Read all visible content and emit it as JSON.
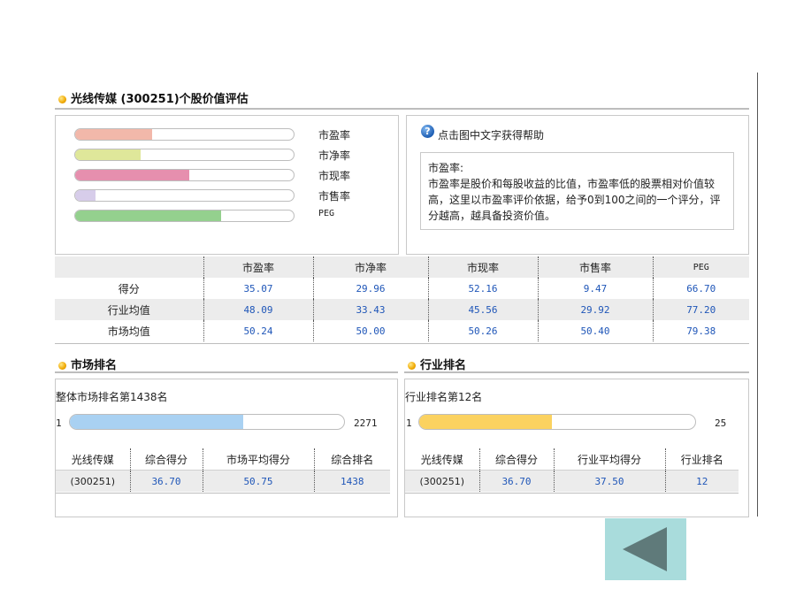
{
  "page": {
    "title": "光线传媒 (300251)个股价值评估",
    "colors": {
      "accent_blue": "#1f56b8",
      "section_rule": "#bdbdbd",
      "back_button_bg": "#a9dcdc",
      "back_arrow": "#5f7a7a"
    }
  },
  "chart_data": {
    "type": "bar",
    "orientation": "horizontal",
    "categories": [
      "市盈率",
      "市净率",
      "市现率",
      "市售率",
      "PEG"
    ],
    "values": [
      35.07,
      29.96,
      52.16,
      9.47,
      66.7
    ],
    "xlim": [
      0,
      100
    ],
    "colors": [
      "#f2b8aa",
      "#dfe79a",
      "#e68fae",
      "#d7cdea",
      "#94d08e"
    ]
  },
  "help": {
    "title": "点击图中文字获得帮助",
    "term": "市盈率:",
    "text": "市盈率是股价和每股收益的比值，市盈率低的股票相对价值较高，这里以市盈率评价依据，给予0到100之间的一个评分，评分越高，越具备投资价值。"
  },
  "score_table": {
    "headers": [
      "",
      "市盈率",
      "市净率",
      "市现率",
      "市售率",
      "PEG"
    ],
    "rows": [
      {
        "label": "得分",
        "values": [
          "35.07",
          "29.96",
          "52.16",
          "9.47",
          "66.70"
        ]
      },
      {
        "label": "行业均值",
        "values": [
          "48.09",
          "33.43",
          "45.56",
          "29.92",
          "77.20"
        ]
      },
      {
        "label": "市场均值",
        "values": [
          "50.24",
          "50.00",
          "50.26",
          "50.40",
          "79.38"
        ]
      }
    ]
  },
  "market_rank": {
    "title": "市场排名",
    "caption": "整体市场排名第1438名",
    "min": "1",
    "max": "2271",
    "position": 1438,
    "total": 2271,
    "fill_color": "#a9d1f2",
    "headers": [
      "光线传媒",
      "综合得分",
      "市场平均得分",
      "综合排名"
    ],
    "row": [
      "(300251)",
      "36.70",
      "50.75",
      "1438"
    ]
  },
  "industry_rank": {
    "title": "行业排名",
    "caption": "行业排名第12名",
    "min": "1",
    "max": "25",
    "position": 12,
    "total": 25,
    "fill_color": "#fbd260",
    "headers": [
      "光线传媒",
      "综合得分",
      "行业平均得分",
      "行业排名"
    ],
    "row": [
      "(300251)",
      "36.70",
      "37.50",
      "12"
    ]
  }
}
